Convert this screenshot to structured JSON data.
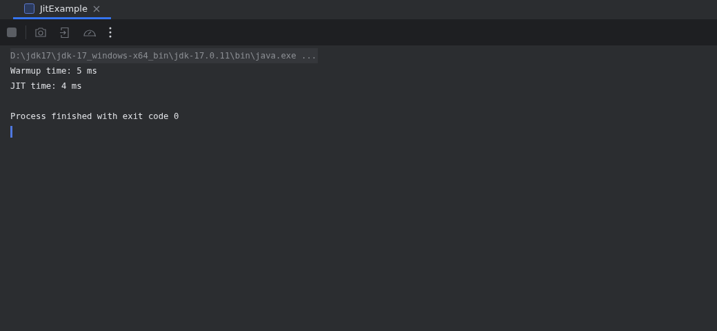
{
  "tabs": [
    {
      "label": "JitExample",
      "selected": true
    }
  ],
  "console": {
    "lines": [
      {
        "kind": "command",
        "text": "D:\\jdk17\\jdk-17_windows-x64_bin\\jdk-17.0.11\\bin\\java.exe ..."
      },
      {
        "kind": "output",
        "text": "Warmup time: 5 ms"
      },
      {
        "kind": "output",
        "text": "JIT time: 4 ms"
      },
      {
        "kind": "status",
        "text": "Process finished with exit code 0"
      }
    ],
    "cursor": true
  }
}
